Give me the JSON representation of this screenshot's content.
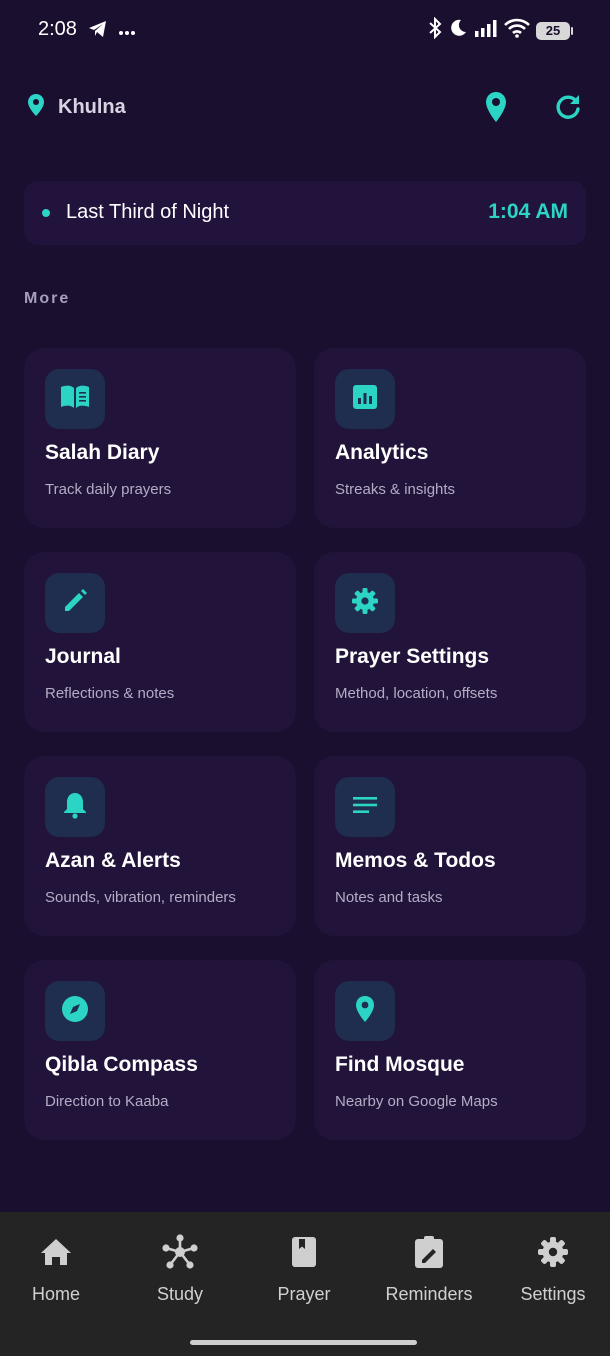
{
  "status_bar": {
    "time": "2:08",
    "battery": "25"
  },
  "header": {
    "location": "Khulna"
  },
  "night_card": {
    "label": "Last Third of Night",
    "time": "1:04 AM"
  },
  "section": {
    "title": "More"
  },
  "cards": [
    {
      "title": "Salah Diary",
      "subtitle": "Track daily prayers",
      "icon": "book-icon"
    },
    {
      "title": "Analytics",
      "subtitle": "Streaks & insights",
      "icon": "chart-icon"
    },
    {
      "title": "Journal",
      "subtitle": "Reflections & notes",
      "icon": "pencil-icon"
    },
    {
      "title": "Prayer Settings",
      "subtitle": "Method, location, offsets",
      "icon": "gear-icon"
    },
    {
      "title": "Azan & Alerts",
      "subtitle": "Sounds, vibration, reminders",
      "icon": "bell-icon"
    },
    {
      "title": "Memos & Todos",
      "subtitle": "Notes and tasks",
      "icon": "lines-icon"
    },
    {
      "title": "Qibla Compass",
      "subtitle": "Direction to Kaaba",
      "icon": "compass-icon"
    },
    {
      "title": "Find Mosque",
      "subtitle": "Nearby on Google Maps",
      "icon": "location-pin-icon"
    }
  ],
  "bottom_nav": [
    {
      "label": "Home",
      "icon": "home-icon"
    },
    {
      "label": "Study",
      "icon": "network-icon"
    },
    {
      "label": "Prayer",
      "icon": "book-icon"
    },
    {
      "label": "Reminders",
      "icon": "clipboard-edit-icon"
    },
    {
      "label": "Settings",
      "icon": "gear-icon"
    }
  ],
  "colors": {
    "background": "#1a0f2e",
    "card": "#211339",
    "accent": "#2bd4c4",
    "nav_background": "#242424"
  }
}
